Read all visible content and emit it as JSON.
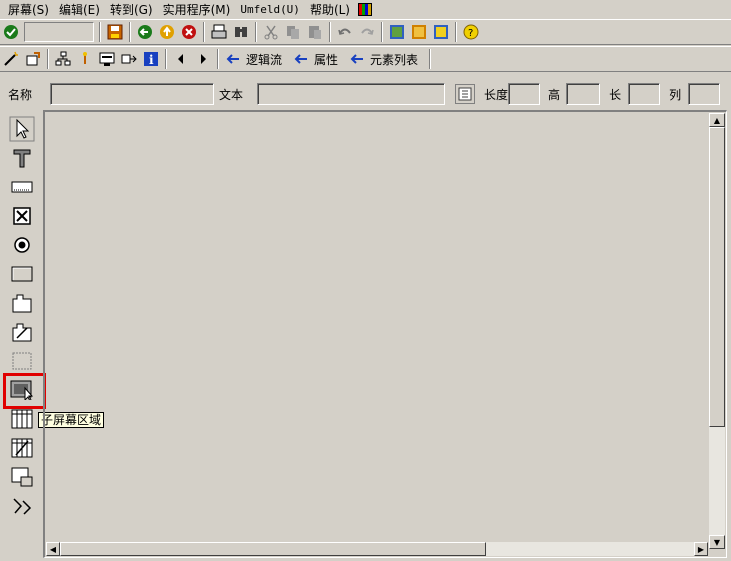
{
  "menubar": {
    "items": [
      "屏幕(S)",
      "编辑(E)",
      "转到(G)",
      "实用程序(M)",
      "Umfeld(U)",
      "帮助(L)"
    ],
    "color_icon": "color-palette-icon"
  },
  "toolbar1": {
    "icons": [
      "check-icon",
      "save-icon",
      "back-icon",
      "exit-icon",
      "cancel-icon",
      "print-icon",
      "find-icon",
      "cut-icon",
      "copy-icon",
      "paste-icon",
      "undo-icon",
      "redo-icon",
      "layout-icon",
      "window-icon",
      "window-yellow-icon",
      "help-icon"
    ]
  },
  "toolbar2": {
    "icons": [
      "wand-icon",
      "activate-icon",
      "hierarchy-icon",
      "dictionary-icon",
      "screen-icon",
      "navigate-icon",
      "info-icon",
      "prev-icon",
      "next-icon"
    ],
    "links": [
      "逻辑流",
      "属性",
      "元素列表"
    ]
  },
  "attributes": {
    "name_label": "名称",
    "text_label": "文本",
    "length_label": "长度",
    "height_label": "高",
    "line_label": "长",
    "col_label": "列",
    "name_value": "",
    "text_value": ""
  },
  "palette": {
    "items": [
      "pointer-icon",
      "text-icon",
      "input-field-icon",
      "checkbox-icon",
      "radio-button-icon",
      "pushbutton-icon",
      "tabstrip-icon",
      "tabstrip-wizard-icon",
      "box-icon",
      "subscreen-area-icon",
      "table-control-icon",
      "table-control-wizard-icon",
      "custom-control-icon",
      "status-icon"
    ],
    "tooltip": "子屏幕区域"
  },
  "colors": {
    "background": "#d4d0c8",
    "highlight": "#e00000",
    "tooltip_bg": "#ffffe1"
  }
}
